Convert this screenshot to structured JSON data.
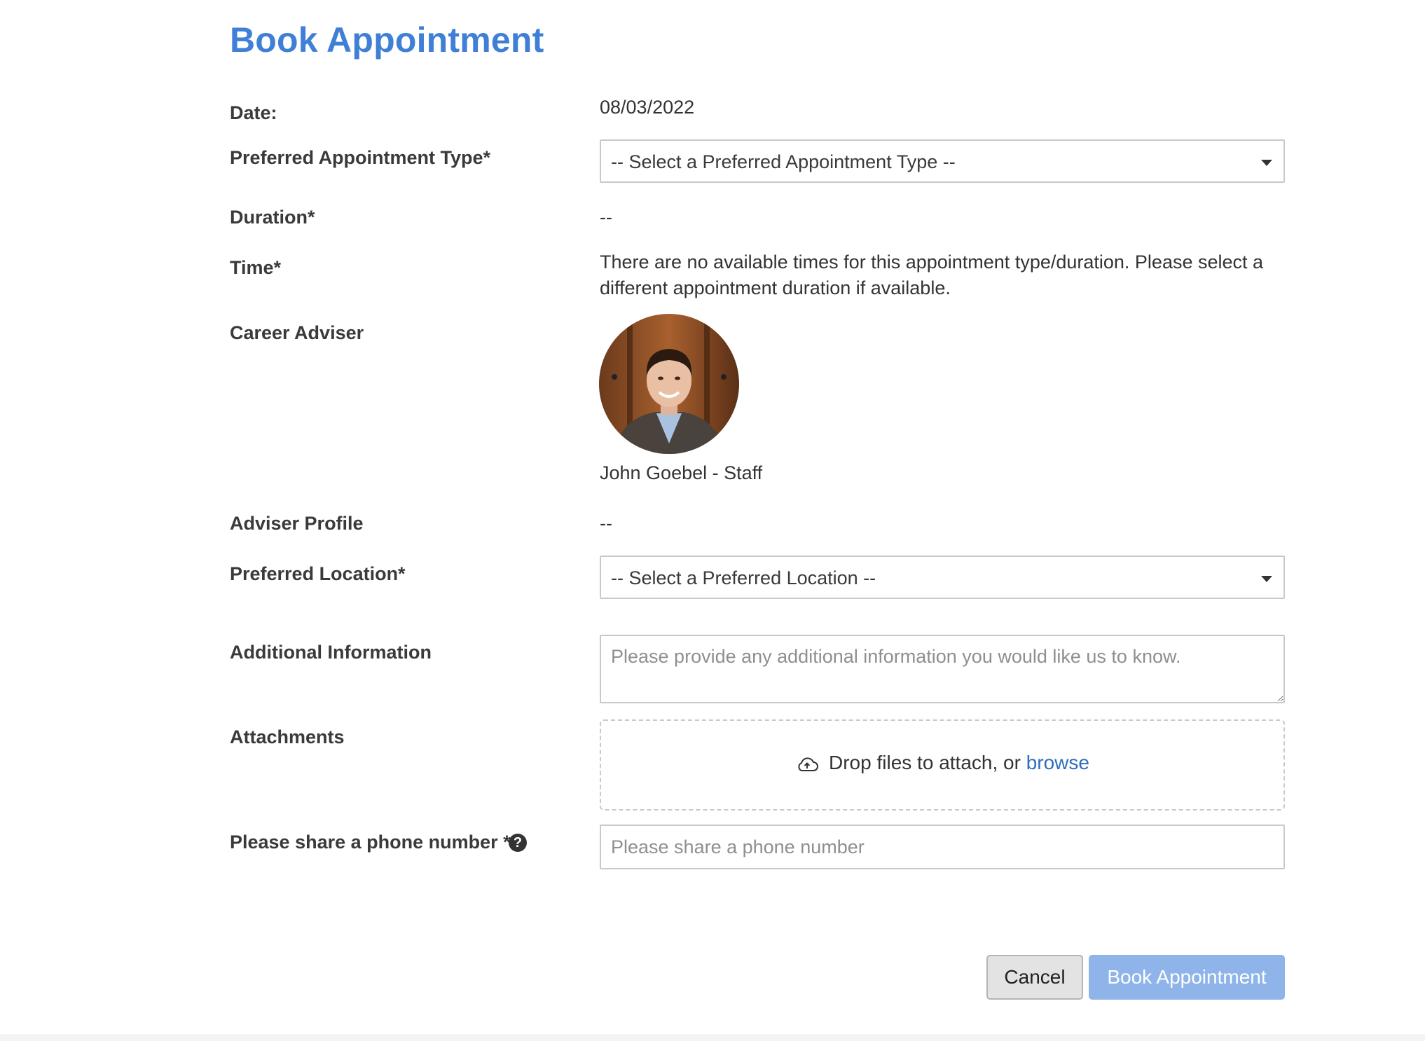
{
  "page": {
    "title": "Book Appointment"
  },
  "form": {
    "date": {
      "label": "Date:",
      "value": "08/03/2022"
    },
    "appointment_type": {
      "label": "Preferred Appointment Type*",
      "selected": "-- Select a Preferred Appointment Type --"
    },
    "duration": {
      "label": "Duration*",
      "value": "--"
    },
    "time": {
      "label": "Time*",
      "message": "There are no available times for this appointment type/duration. Please select a different appointment duration if available."
    },
    "adviser": {
      "label": "Career Adviser",
      "name": "John Goebel - Staff"
    },
    "adviser_profile": {
      "label": "Adviser Profile",
      "value": "--"
    },
    "location": {
      "label": "Preferred Location*",
      "selected": "-- Select a Preferred Location --"
    },
    "additional_info": {
      "label": "Additional Information",
      "placeholder": "Please provide any additional information you would like us to know."
    },
    "attachments": {
      "label": "Attachments",
      "drop_text": "Drop files to attach, or ",
      "browse_text": "browse",
      "icon": "cloud-upload-icon"
    },
    "phone": {
      "label": "Please share a phone number *",
      "placeholder": "Please share a phone number",
      "help_icon": "question-circle-icon"
    }
  },
  "actions": {
    "cancel_label": "Cancel",
    "book_label": "Book Appointment"
  },
  "colors": {
    "title": "#3f7fd6",
    "link": "#2f6dbd",
    "primary_button": "#8fb4ea",
    "cancel_button": "#e3e3e3"
  }
}
